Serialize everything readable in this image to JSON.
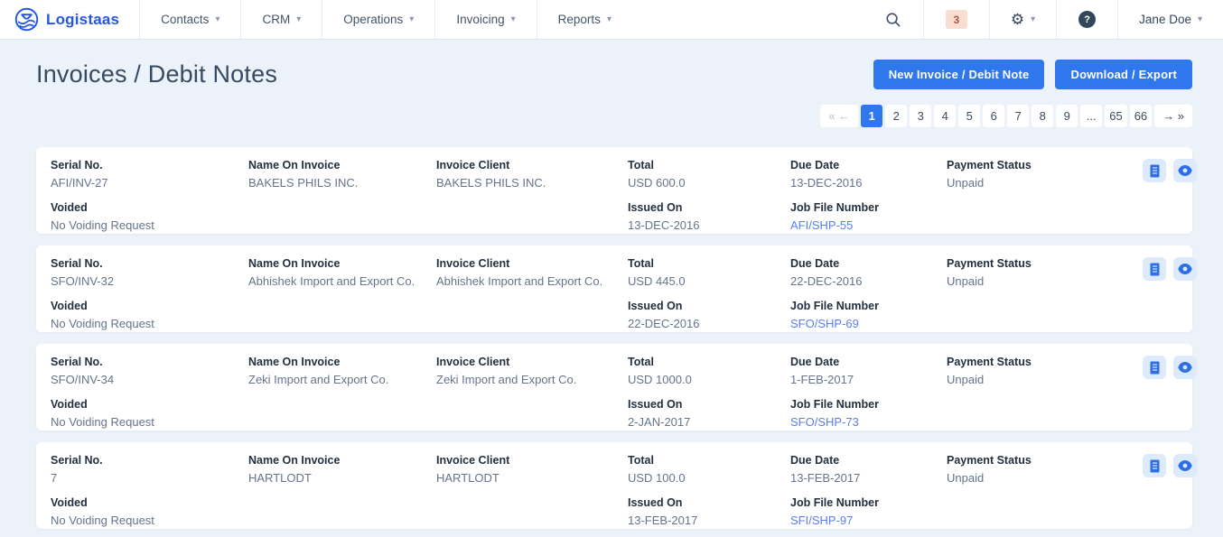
{
  "navbar": {
    "brand": "Logistaas",
    "menu": [
      {
        "label": "Contacts"
      },
      {
        "label": "CRM"
      },
      {
        "label": "Operations"
      },
      {
        "label": "Invoicing"
      },
      {
        "label": "Reports"
      }
    ],
    "notification_count": "3",
    "user_name": "Jane Doe"
  },
  "icons": {
    "caret_down": "▾",
    "gear": "⚙",
    "question": "?"
  },
  "header": {
    "title": "Invoices / Debit Notes",
    "new_button": "New Invoice / Debit Note",
    "download_button": "Download / Export"
  },
  "pagination": {
    "prev": "« ←",
    "next": "→ »",
    "active_page": "1",
    "pages": [
      "1",
      "2",
      "3",
      "4",
      "5",
      "6",
      "7",
      "8",
      "9",
      "...",
      "65",
      "66"
    ]
  },
  "labels": {
    "serial": "Serial No.",
    "voided": "Voided",
    "name_on_invoice": "Name On Invoice",
    "invoice_client": "Invoice Client",
    "total": "Total",
    "issued_on": "Issued On",
    "due_date": "Due Date",
    "job_file_number": "Job File Number",
    "payment_status": "Payment Status"
  },
  "invoices": [
    {
      "serial": "AFI/INV-27",
      "voided": "No Voiding Request",
      "name_on_invoice": "BAKELS PHILS INC.",
      "invoice_client": "BAKELS PHILS INC.",
      "total": "USD 600.0",
      "issued_on": "13-DEC-2016",
      "due_date": "13-DEC-2016",
      "job_file_number": "AFI/SHP-55",
      "payment_status": "Unpaid"
    },
    {
      "serial": "SFO/INV-32",
      "voided": "No Voiding Request",
      "name_on_invoice": "Abhishek Import and Export Co.",
      "invoice_client": "Abhishek Import and Export Co.",
      "total": "USD 445.0",
      "issued_on": "22-DEC-2016",
      "due_date": "22-DEC-2016",
      "job_file_number": "SFO/SHP-69",
      "payment_status": "Unpaid"
    },
    {
      "serial": "SFO/INV-34",
      "voided": "No Voiding Request",
      "name_on_invoice": "Zeki Import and Export Co.",
      "invoice_client": "Zeki Import and Export Co.",
      "total": "USD 1000.0",
      "issued_on": "2-JAN-2017",
      "due_date": "1-FEB-2017",
      "job_file_number": "SFO/SHP-73",
      "payment_status": "Unpaid"
    },
    {
      "serial": "7",
      "voided": "No Voiding Request",
      "name_on_invoice": "HARTLODT",
      "invoice_client": "HARTLODT",
      "total": "USD 100.0",
      "issued_on": "13-FEB-2017",
      "due_date": "13-FEB-2017",
      "job_file_number": "SFI/SHP-97",
      "payment_status": "Unpaid"
    }
  ],
  "colors": {
    "brand_blue": "#2457e6",
    "button_blue": "#2e77ed",
    "link_blue": "#5a7df2",
    "action_icon_bg": "#ddeafc",
    "action_icon_fg": "#2e6fe8",
    "badge_bg": "#f9ddd0",
    "badge_text": "#a8584a",
    "dark_navy": "#33475b",
    "page_bg": "#ecf2f9"
  }
}
